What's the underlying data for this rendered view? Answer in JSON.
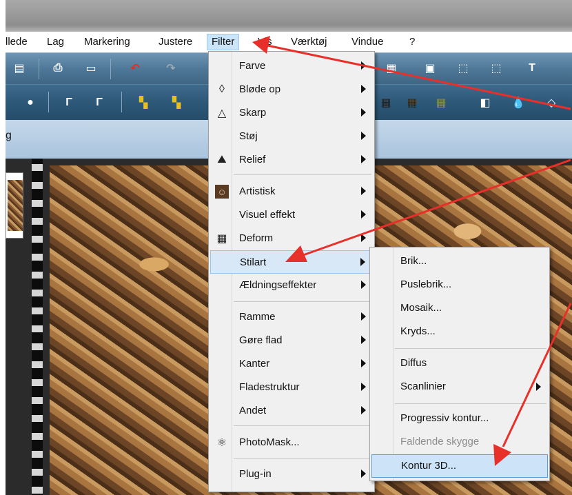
{
  "menubar": {
    "items": [
      "llede",
      "Lag",
      "Markering",
      "Justere",
      "Filter",
      "Vis",
      "Værktøj",
      "Vindue",
      "?"
    ],
    "active": "Filter"
  },
  "document": {
    "title_fragment": "g"
  },
  "toolbar_icons": [
    "open-icon",
    "print-icon",
    "scan-icon",
    "undo-icon",
    "redo-icon",
    "batch-icon",
    "export-icon",
    "crop-icon",
    "text-icon"
  ],
  "filter_menu": {
    "items": [
      {
        "label": "Farve",
        "icon": "",
        "submenu": true
      },
      {
        "label": "Bløde op",
        "icon": "drop-outline-icon",
        "submenu": true
      },
      {
        "label": "Skarp",
        "icon": "triangle-outline-icon",
        "submenu": true
      },
      {
        "label": "Støj",
        "icon": "",
        "submenu": true
      },
      {
        "label": "Relief",
        "icon": "relief-icon",
        "submenu": true
      },
      {
        "label": "Artistisk",
        "icon": "portrait-icon",
        "submenu": true
      },
      {
        "label": "Visuel effekt",
        "icon": "",
        "submenu": true
      },
      {
        "label": "Deform",
        "icon": "grid-warp-icon",
        "submenu": true
      },
      {
        "label": "Stilart",
        "icon": "",
        "submenu": true,
        "highlighted": true
      },
      {
        "label": "Ældningseffekter",
        "icon": "",
        "submenu": true
      },
      {
        "label": "Ramme",
        "icon": "",
        "submenu": true
      },
      {
        "label": "Gøre flad",
        "icon": "",
        "submenu": true
      },
      {
        "label": "Kanter",
        "icon": "",
        "submenu": true
      },
      {
        "label": "Fladestruktur",
        "icon": "",
        "submenu": true
      },
      {
        "label": "Andet",
        "icon": "",
        "submenu": true
      },
      {
        "label": "PhotoMask...",
        "icon": "photomask-icon",
        "submenu": false
      },
      {
        "label": "Plug-in",
        "icon": "",
        "submenu": true
      }
    ]
  },
  "stilart_submenu": {
    "items": [
      {
        "label": "Brik...",
        "submenu": false
      },
      {
        "label": "Puslebrik...",
        "submenu": false
      },
      {
        "label": "Mosaik...",
        "submenu": false
      },
      {
        "label": "Kryds...",
        "submenu": false
      },
      {
        "label": "Diffus",
        "submenu": false
      },
      {
        "label": "Scanlinier",
        "submenu": true
      },
      {
        "label": "Progressiv kontur...",
        "submenu": false
      },
      {
        "label": "Faldende skygge",
        "submenu": false,
        "disabled": true
      },
      {
        "label": "Kontur 3D...",
        "submenu": false,
        "highlighted": true
      }
    ]
  },
  "colors": {
    "arrow": "#e8302a",
    "highlight": "#cde3f7",
    "highlight_border": "#5b9bd5"
  }
}
